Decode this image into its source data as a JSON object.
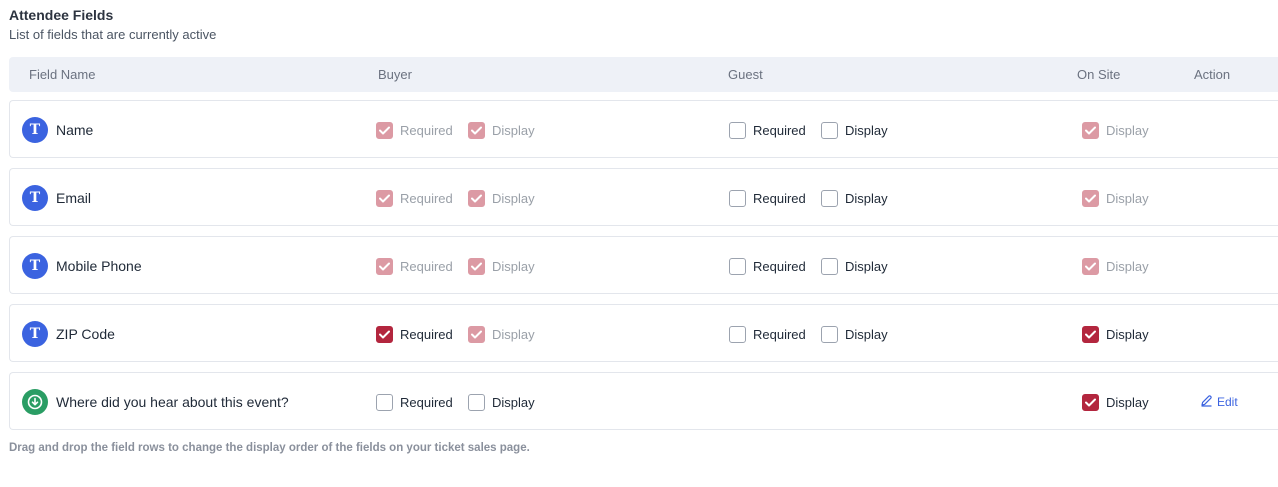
{
  "section": {
    "title": "Attendee Fields",
    "subtitle": "List of fields that are currently active"
  },
  "columns": {
    "field_name": "Field Name",
    "buyer": "Buyer",
    "guest": "Guest",
    "on_site": "On Site",
    "action": "Action"
  },
  "labels": {
    "required": "Required",
    "display": "Display",
    "edit": "Edit"
  },
  "colors": {
    "checked": "#b3263e",
    "checked_disabled": "#dc9aa4",
    "text_icon": "#3b63e0",
    "dropdown_icon": "#2a9d64"
  },
  "rows": [
    {
      "name": "Name",
      "icon": "text-type-icon",
      "buyer_required": "checked-disabled",
      "buyer_display": "checked-disabled",
      "guest_required": "unchecked",
      "guest_display": "unchecked",
      "onsite_display": "checked-disabled",
      "editable": false
    },
    {
      "name": "Email",
      "icon": "text-type-icon",
      "buyer_required": "checked-disabled",
      "buyer_display": "checked-disabled",
      "guest_required": "unchecked",
      "guest_display": "unchecked",
      "onsite_display": "checked-disabled",
      "editable": false
    },
    {
      "name": "Mobile Phone",
      "icon": "text-type-icon",
      "buyer_required": "checked-disabled",
      "buyer_display": "checked-disabled",
      "guest_required": "unchecked",
      "guest_display": "unchecked",
      "onsite_display": "checked-disabled",
      "editable": false
    },
    {
      "name": "ZIP Code",
      "icon": "text-type-icon",
      "buyer_required": "checked",
      "buyer_display": "checked-disabled",
      "guest_required": "unchecked",
      "guest_display": "unchecked",
      "onsite_display": "checked",
      "editable": false
    },
    {
      "name": "Where did you hear about this event?",
      "icon": "dropdown-type-icon",
      "buyer_required": "unchecked",
      "buyer_display": "unchecked",
      "guest_required": null,
      "guest_display": null,
      "onsite_display": "checked",
      "editable": true
    }
  ],
  "footer": "Drag and drop the field rows to change the display order of the fields on your ticket sales page."
}
